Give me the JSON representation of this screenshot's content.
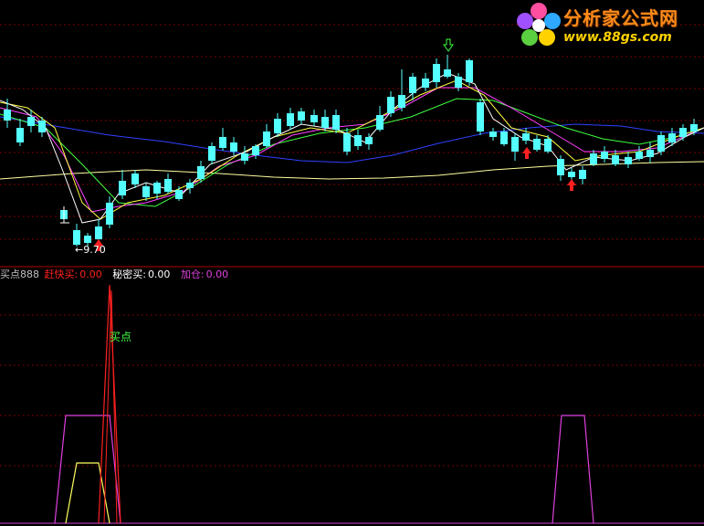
{
  "watermark": {
    "title": "分析家公式网",
    "url": "www.88gs.com"
  },
  "price_panel": {
    "low_marker": "←9.70"
  },
  "legend": {
    "name": "买点888",
    "items": [
      {
        "label": "赶快买:",
        "value": "0.00",
        "color": "#ff2020"
      },
      {
        "label": "秘密买:",
        "value": "0.00",
        "color": "#ffffff"
      },
      {
        "label": "加仓:",
        "value": "0.00",
        "color": "#e040e0"
      }
    ]
  },
  "indicator_panel": {
    "signal_label": "买点"
  },
  "colors": {
    "up": "#ff3030",
    "down": "#54ffff",
    "ma5": "#ffffff",
    "ma10": "#ffff40",
    "ma20": "#ff40ff",
    "ma30": "#40ff40",
    "ma60": "#3040ff",
    "ma120": "#ffffa0",
    "grid": "#7a0000"
  }
}
